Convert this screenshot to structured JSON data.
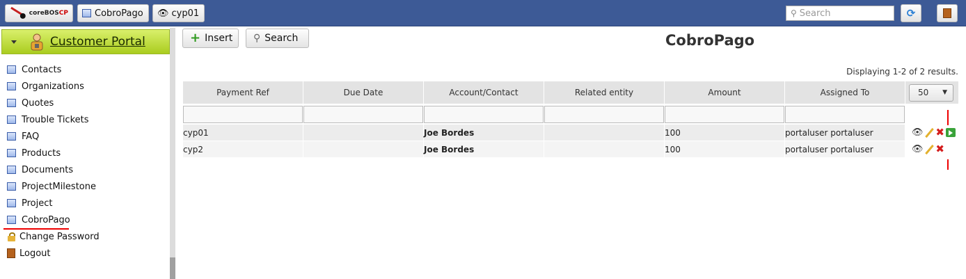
{
  "topbar": {
    "logo_text_prefix": "coreBOS",
    "logo_text_suffix": "CP",
    "breadcrumbs": [
      "CobroPago",
      "cyp01"
    ],
    "search_placeholder": "Search"
  },
  "sidebar": {
    "title": "Customer Portal",
    "items": [
      {
        "label": "Contacts",
        "icon": "module-icon"
      },
      {
        "label": "Organizations",
        "icon": "module-icon"
      },
      {
        "label": "Quotes",
        "icon": "module-icon"
      },
      {
        "label": "Trouble Tickets",
        "icon": "module-icon"
      },
      {
        "label": "FAQ",
        "icon": "module-icon"
      },
      {
        "label": "Products",
        "icon": "module-icon"
      },
      {
        "label": "Documents",
        "icon": "module-icon"
      },
      {
        "label": "ProjectMilestone",
        "icon": "module-icon"
      },
      {
        "label": "Project",
        "icon": "module-icon"
      },
      {
        "label": "CobroPago",
        "icon": "module-icon",
        "active": true
      },
      {
        "label": "Change Password",
        "icon": "lock-icon"
      },
      {
        "label": "Logout",
        "icon": "door-icon"
      }
    ]
  },
  "main": {
    "insert_label": "Insert",
    "search_label": "Search",
    "title": "CobroPago",
    "results_info": "Displaying 1-2 of 2 results.",
    "page_size": "50",
    "columns": [
      "Payment Ref",
      "Due Date",
      "Account/Contact",
      "Related entity",
      "Amount",
      "Assigned To"
    ],
    "rows": [
      {
        "payment_ref": "cyp01",
        "due_date": "",
        "account_contact": "Joe Bordes",
        "related_entity": "",
        "amount": "100",
        "assigned_to": "portaluser portaluser"
      },
      {
        "payment_ref": "cyp2",
        "due_date": "",
        "account_contact": "Joe Bordes",
        "related_entity": "",
        "amount": "100",
        "assigned_to": "portaluser portaluser"
      }
    ]
  },
  "colors": {
    "topbar": "#3d5a96",
    "sidebar_header": "#aacc1f",
    "active_underline": "#e00000"
  }
}
